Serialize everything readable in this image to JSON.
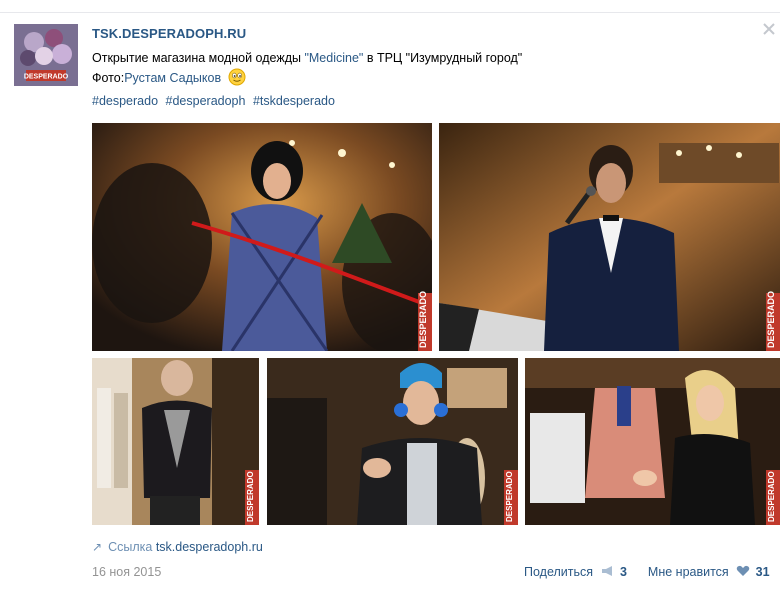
{
  "post": {
    "group_name": "TSK.DESPERADOPH.RU",
    "text_prefix": "Открытие магазина модной одежды ",
    "text_link1": "\"Medicine\"",
    "text_middle": " в ТРЦ \"Изумрудный город\"",
    "photo_label": "Фото:",
    "photo_author": "Рустам Садыков",
    "emoji": "smiling-face-emoji",
    "hashtags": [
      "#desperado",
      "#desperadoph",
      "#tskdesperado"
    ]
  },
  "watermark": "DESPERADO",
  "avatar_label": "DESPERADO",
  "link": {
    "label": "Ссылка",
    "url": "tsk.desperadoph.ru"
  },
  "footer": {
    "date": "16 ноя 2015",
    "share_label": "Поделиться",
    "share_count": "3",
    "like_label": "Мне нравится",
    "like_count": "31"
  },
  "colors": {
    "link": "#2a5885",
    "muted": "#939393",
    "watermark_bg": "#c0392b"
  }
}
